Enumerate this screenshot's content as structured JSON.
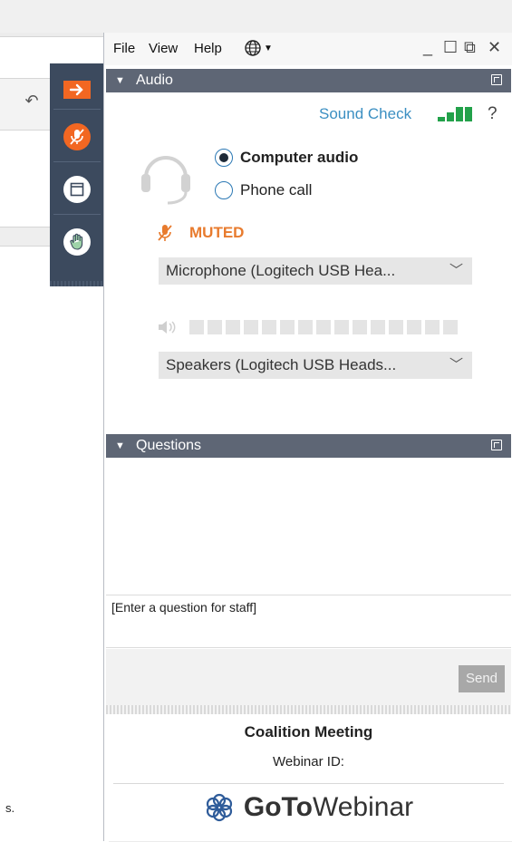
{
  "menu": {
    "file": "File",
    "view": "View",
    "help": "Help"
  },
  "window_controls": {
    "minimize": "_",
    "maximize": "☐",
    "restore": "⧉",
    "close": "✕"
  },
  "audio": {
    "title": "Audio",
    "sound_check": "Sound Check",
    "help": "?",
    "options": [
      "Computer audio",
      "Phone call"
    ],
    "selected_option": "Computer audio",
    "mic_status": "MUTED",
    "microphone": "Microphone (Logitech USB Hea...",
    "speakers": "Speakers (Logitech USB Heads..."
  },
  "questions": {
    "title": "Questions",
    "input_placeholder": "[Enter a question for staff]",
    "send_label": "Send"
  },
  "footer": {
    "meeting_title": "Coalition Meeting",
    "webinar_id_label": "Webinar ID:",
    "brand_goto": "GoTo",
    "brand_webinar": "Webinar"
  },
  "background": {
    "partial_text": "s."
  },
  "colors": {
    "accent_orange": "#f26722",
    "header": "#5e6675",
    "link": "#3b8fc2",
    "signal": "#22a14a",
    "control_bar": "#3c4a5e"
  }
}
